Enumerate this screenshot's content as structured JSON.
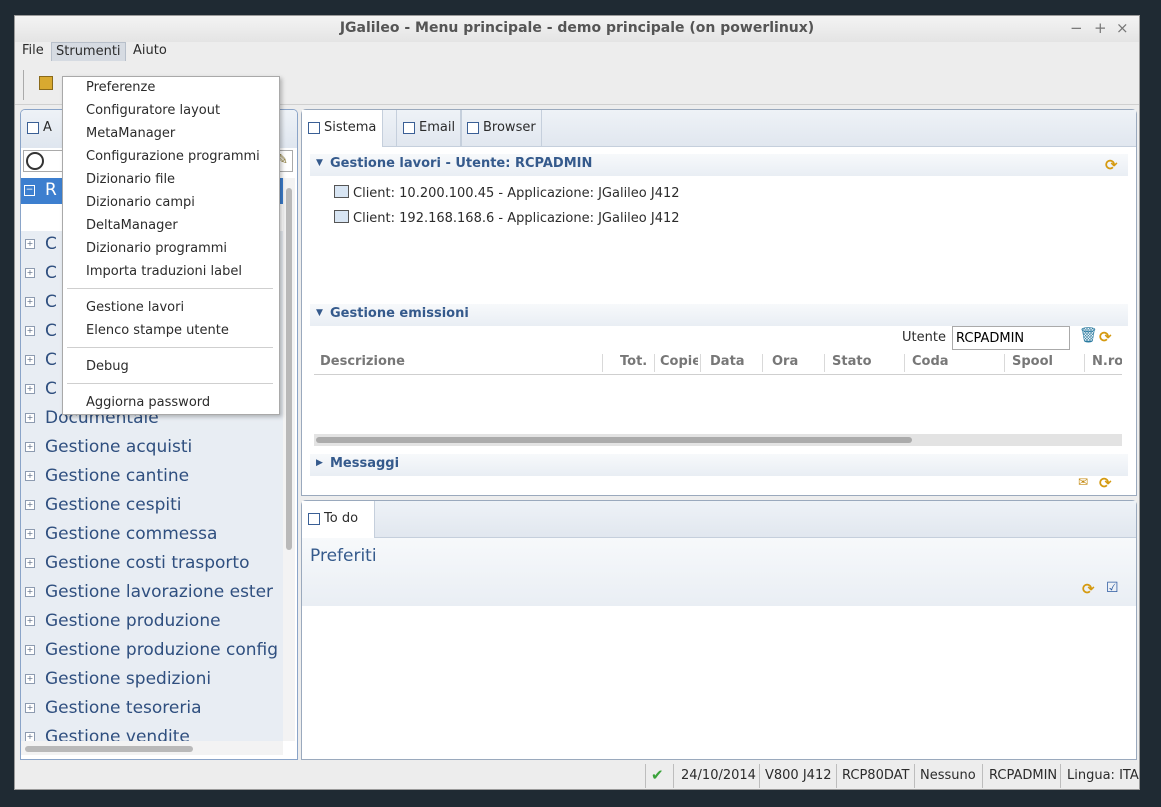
{
  "window": {
    "title": "JGalileo - Menu principale - demo principale  (on powerlinux)",
    "controls": [
      "−",
      "+",
      "×"
    ]
  },
  "menubar": {
    "file": "File",
    "strumenti": "Strumenti",
    "aiuto": "Aiuto"
  },
  "dropdown": {
    "items": [
      "Preferenze",
      "Configuratore layout",
      "MetaManager",
      "Configurazione programmi",
      "Dizionario file",
      "Dizionario campi",
      "DeltaManager",
      "Dizionario programmi",
      "Importa traduzioni label"
    ],
    "group2": [
      "Gestione lavori",
      "Elenco stampe utente"
    ],
    "debug": "Debug",
    "password": "Aggiorna password"
  },
  "left": {
    "tab_letter": "A",
    "root_letter": "R",
    "hidden_letters": [
      "C",
      "C",
      "C",
      "C",
      "C",
      "C"
    ],
    "items": [
      "Documentale",
      "Gestione acquisti",
      "Gestione cantine",
      "Gestione cespiti",
      "Gestione commessa",
      "Gestione costi trasporto",
      "Gestione lavorazione ester",
      "Gestione produzione",
      "Gestione produzione config",
      "Gestione spedizioni",
      "Gestione tesoreria",
      "Gestione vendite"
    ]
  },
  "tabs": {
    "sistema": "Sistema",
    "email": "Email",
    "browser": "Browser"
  },
  "lavori": {
    "title": "Gestione lavori - Utente: RCPADMIN",
    "clients": [
      "Client: 10.200.100.45 - Applicazione: JGalileo J412",
      "Client: 192.168.168.6 - Applicazione: JGalileo J412"
    ]
  },
  "emissioni": {
    "title": "Gestione emissioni",
    "utente_label": "Utente",
    "utente_value": "RCPADMIN",
    "columns": [
      "Descrizione",
      "Tot.",
      "Copie",
      "Data",
      "Ora",
      "Stato",
      "Coda",
      "Spool",
      "N.ro"
    ]
  },
  "messaggi": {
    "title": "Messaggi"
  },
  "todo": {
    "tab": "To do",
    "preferiti": "Preferiti"
  },
  "status": {
    "date": "24/10/2014",
    "version": "V800 J412",
    "dat": "RCP80DAT",
    "none": "Nessuno",
    "user": "RCPADMIN",
    "lingua": "Lingua: ITA"
  },
  "colors": {
    "accent": "#3d7fcf",
    "section_text": "#355a8c",
    "refresh": "#d59a10"
  }
}
